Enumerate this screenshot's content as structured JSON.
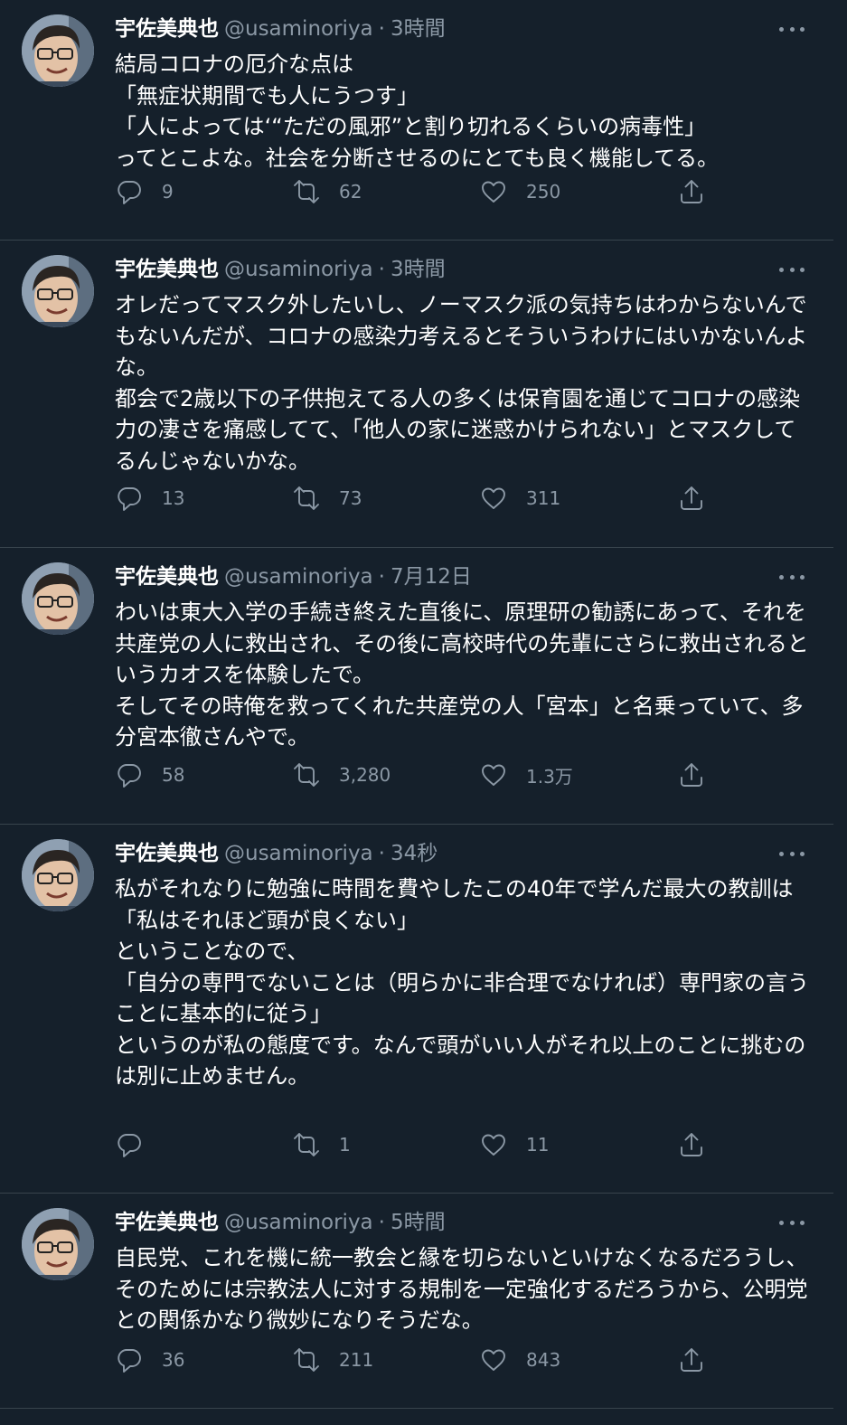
{
  "author": {
    "name": "宇佐美典也",
    "handle": "@usaminoriya",
    "separator": "·",
    "more_icon": "more-horizontal-icon"
  },
  "tweets": [
    {
      "time": "3時間",
      "text": "結局コロナの厄介な点は\n「無症状期間でも人にうつす」\n「人によっては‘“ただの風邪”と割り切れるくらいの病毒性」\nってとこよな。社会を分断させるのにとても良く機能してる。",
      "replies": "9",
      "retweets": "62",
      "likes": "250"
    },
    {
      "time": "3時間",
      "text": "オレだってマスク外したいし、ノーマスク派の気持ちはわからないんでもないんだが、コロナの感染力考えるとそういうわけにはいかないんよな。\n都会で2歳以下の子供抱えてる人の多くは保育園を通じてコロナの感染力の凄さを痛感してて、「他人の家に迷惑かけられない」とマスクしてるんじゃないかな。",
      "replies": "13",
      "retweets": "73",
      "likes": "311"
    },
    {
      "time": "7月12日",
      "text": "わいは東大入学の手続き終えた直後に、原理研の勧誘にあって、それを共産党の人に救出され、その後に高校時代の先輩にさらに救出されるというカオスを体験したで。\nそしてその時俺を救ってくれた共産党の人「宮本」と名乗っていて、多分宮本徹さんやで。",
      "replies": "58",
      "retweets": "3,280",
      "likes": "1.3万"
    },
    {
      "time": "34秒",
      "text": "私がそれなりに勉強に時間を費やしたこの40年で学んだ最大の教訓は\n「私はそれほど頭が良くない」\nということなので、\n「自分の専門でないことは（明らかに非合理でなければ）専門家の言うことに基本的に従う」\nというのが私の態度です。なんで頭がいい人がそれ以上のことに挑むのは別に止めません。",
      "replies": "",
      "retweets": "1",
      "likes": "11"
    },
    {
      "time": "5時間",
      "text": "自民党、これを機に統一教会と縁を切らないといけなくなるだろうし、そのためには宗教法人に対する規制を一定強化するだろうから、公明党との関係かなり微妙になりそうだな。",
      "replies": "36",
      "retweets": "211",
      "likes": "843"
    }
  ]
}
